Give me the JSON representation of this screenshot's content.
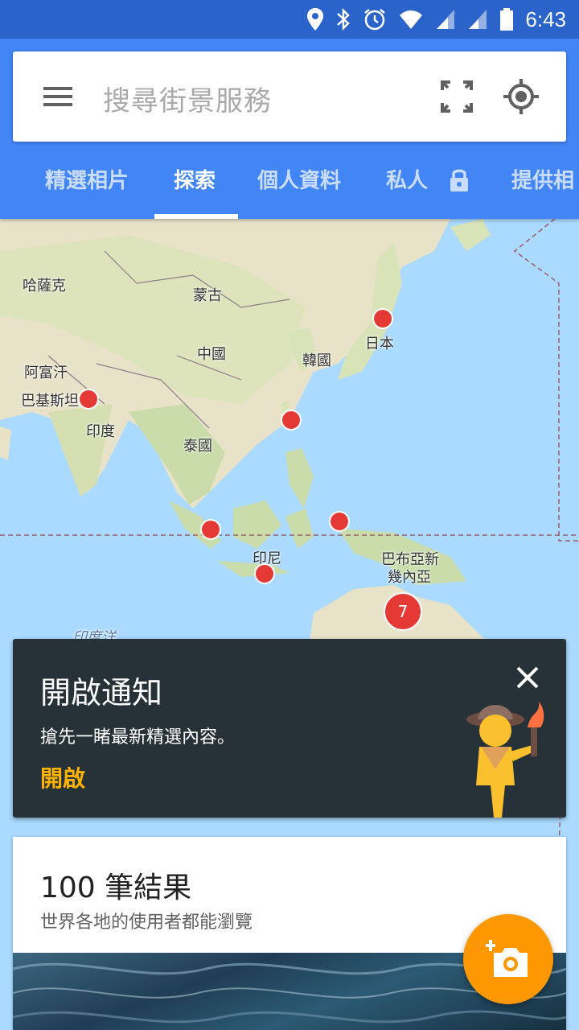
{
  "status_bar": {
    "time": "6:43"
  },
  "search": {
    "placeholder": "搜尋街景服務"
  },
  "tabs": [
    {
      "label": "精選相片"
    },
    {
      "label": "探索"
    },
    {
      "label": "個人資料"
    },
    {
      "label": "私人"
    },
    {
      "label": "提供相"
    }
  ],
  "map": {
    "labels": [
      "哈薩克",
      "蒙古",
      "中國",
      "韓國",
      "日本",
      "阿富汗",
      "巴基斯坦",
      "印度",
      "泰國",
      "印尼",
      "巴布亞新",
      "幾內亞",
      "印度洋"
    ],
    "cluster_count": "7"
  },
  "notification": {
    "title": "開啟通知",
    "description": "搶先一睹最新精選內容。",
    "action": "開啟"
  },
  "results": {
    "title": "100 筆結果",
    "subtitle": "世界各地的使用者都能瀏覽"
  },
  "colors": {
    "app_bar": "#4285f4",
    "status_bar": "#2a63c9",
    "fab": "#ff9800",
    "pin": "#e53935",
    "notif_bg": "#263238",
    "notif_action": "#ffb300"
  }
}
